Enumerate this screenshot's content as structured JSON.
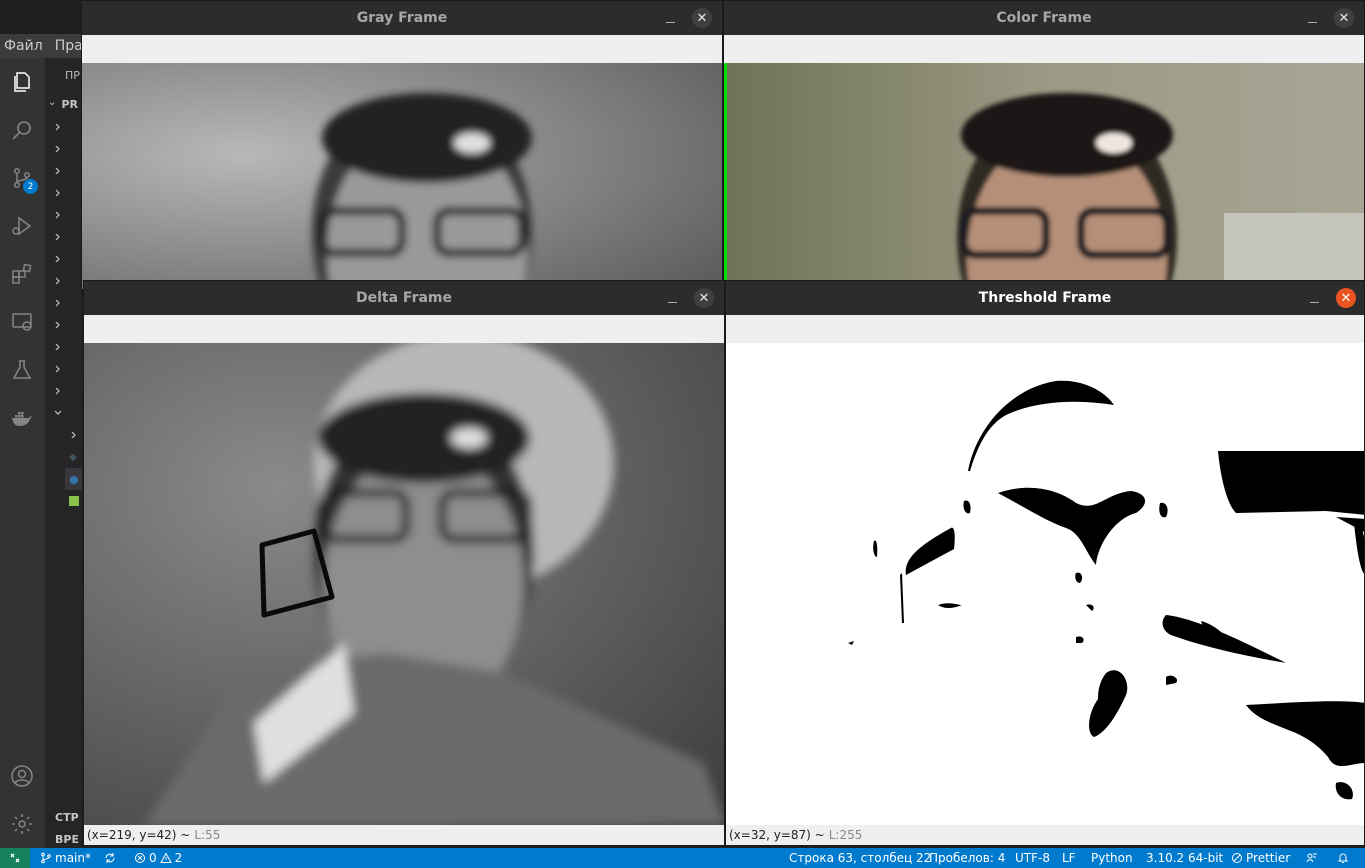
{
  "vscode": {
    "menu": [
      "Файл",
      "Пра"
    ],
    "sidebar": {
      "section_header": "ПР",
      "project_header": "PR",
      "bottom_sections": [
        "СТР",
        "ВРЕ"
      ]
    },
    "activity_bar": {
      "icons": [
        "files-icon",
        "search-icon",
        "source-control-icon",
        "run-debug-icon",
        "extensions-icon",
        "remote-explorer-icon",
        "testing-icon",
        "docker-icon",
        "account-icon",
        "settings-gear-icon"
      ],
      "source_control_badge": "2"
    },
    "statusbar": {
      "branch": "main*",
      "errors": "0",
      "warnings": "2",
      "cursor": "Строка 63, столбец 22",
      "indent": "Пробелов: 4",
      "encoding": "UTF-8",
      "eol": "LF",
      "language": "Python",
      "interpreter": "3.10.2 64-bit",
      "formatter": "Prettier"
    }
  },
  "windows": {
    "gray": {
      "title": "Gray Frame"
    },
    "color": {
      "title": "Color Frame"
    },
    "delta": {
      "title": "Delta Frame",
      "status_coords": "(x=219, y=42) ~",
      "status_lum": "L:55"
    },
    "threshold": {
      "title": "Threshold Frame",
      "status_coords": "(x=32, y=87) ~",
      "status_lum": "L:255"
    }
  },
  "colors": {
    "statusbar": "#007acc",
    "remote": "#16825d",
    "close_active": "#e95420",
    "contour": "#00dd00"
  }
}
